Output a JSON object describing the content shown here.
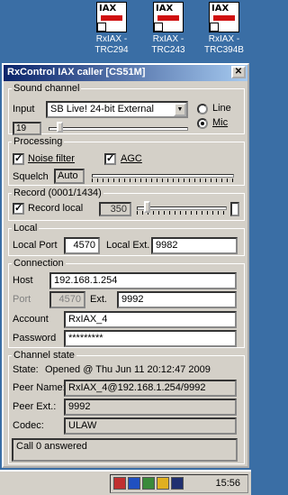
{
  "desktop": {
    "icons": [
      {
        "label_line1": "RxIAX -",
        "label_line2": "TRC294",
        "icon_text": "IAX"
      },
      {
        "label_line1": "RxIAX -",
        "label_line2": "TRC243",
        "icon_text": "IAX"
      },
      {
        "label_line1": "RxIAX -",
        "label_line2": "TRC394B",
        "icon_text": "IAX"
      }
    ]
  },
  "window": {
    "title": "RxControl IAX caller  [CS51M]",
    "close_glyph": "✕"
  },
  "sound_channel": {
    "legend": "Sound channel",
    "input_label": "Input",
    "input_value": "SB Live! 24-bit External",
    "input_level": "19",
    "input_level_fraction": 0.06,
    "line_label": "Line",
    "mic_label": "Mic",
    "selected_source": "Mic"
  },
  "processing": {
    "legend": "Processing",
    "noise_filter_label": "Noise filter",
    "noise_filter_checked": true,
    "agc_label": "AGC",
    "agc_checked": true,
    "squelch_label": "Squelch",
    "squelch_value": "Auto"
  },
  "record": {
    "legend": "Record (0001/1434)",
    "record_local_label": "Record local",
    "record_local_checked": true,
    "record_level": "350",
    "check_glyph": "✓"
  },
  "local": {
    "legend": "Local",
    "port_label": "Local Port",
    "port_value": "4570",
    "ext_label": "Local Ext.",
    "ext_value": "9982"
  },
  "connection": {
    "legend": "Connection",
    "host_label": "Host",
    "host_value": "192.168.1.254",
    "port_label": "Port",
    "port_value": "4570",
    "ext_label": "Ext.",
    "ext_value": "9992",
    "account_label": "Account",
    "account_value": "RxIAX_4",
    "password_label": "Password",
    "password_value": "*********"
  },
  "channel_state": {
    "legend": "Channel state",
    "state_label": "State:",
    "state_value": "Opened @ Thu Jun 11 20:12:47 2009",
    "peer_name_label": "Peer Name:",
    "peer_name_value": "RxIAX_4@192.168.1.254/9992",
    "peer_ext_label": "Peer Ext.:",
    "peer_ext_value": "9992",
    "codec_label": "Codec:",
    "codec_value": "ULAW",
    "log_text": "Call 0 answered"
  },
  "taskbar": {
    "clock": "15:56"
  }
}
